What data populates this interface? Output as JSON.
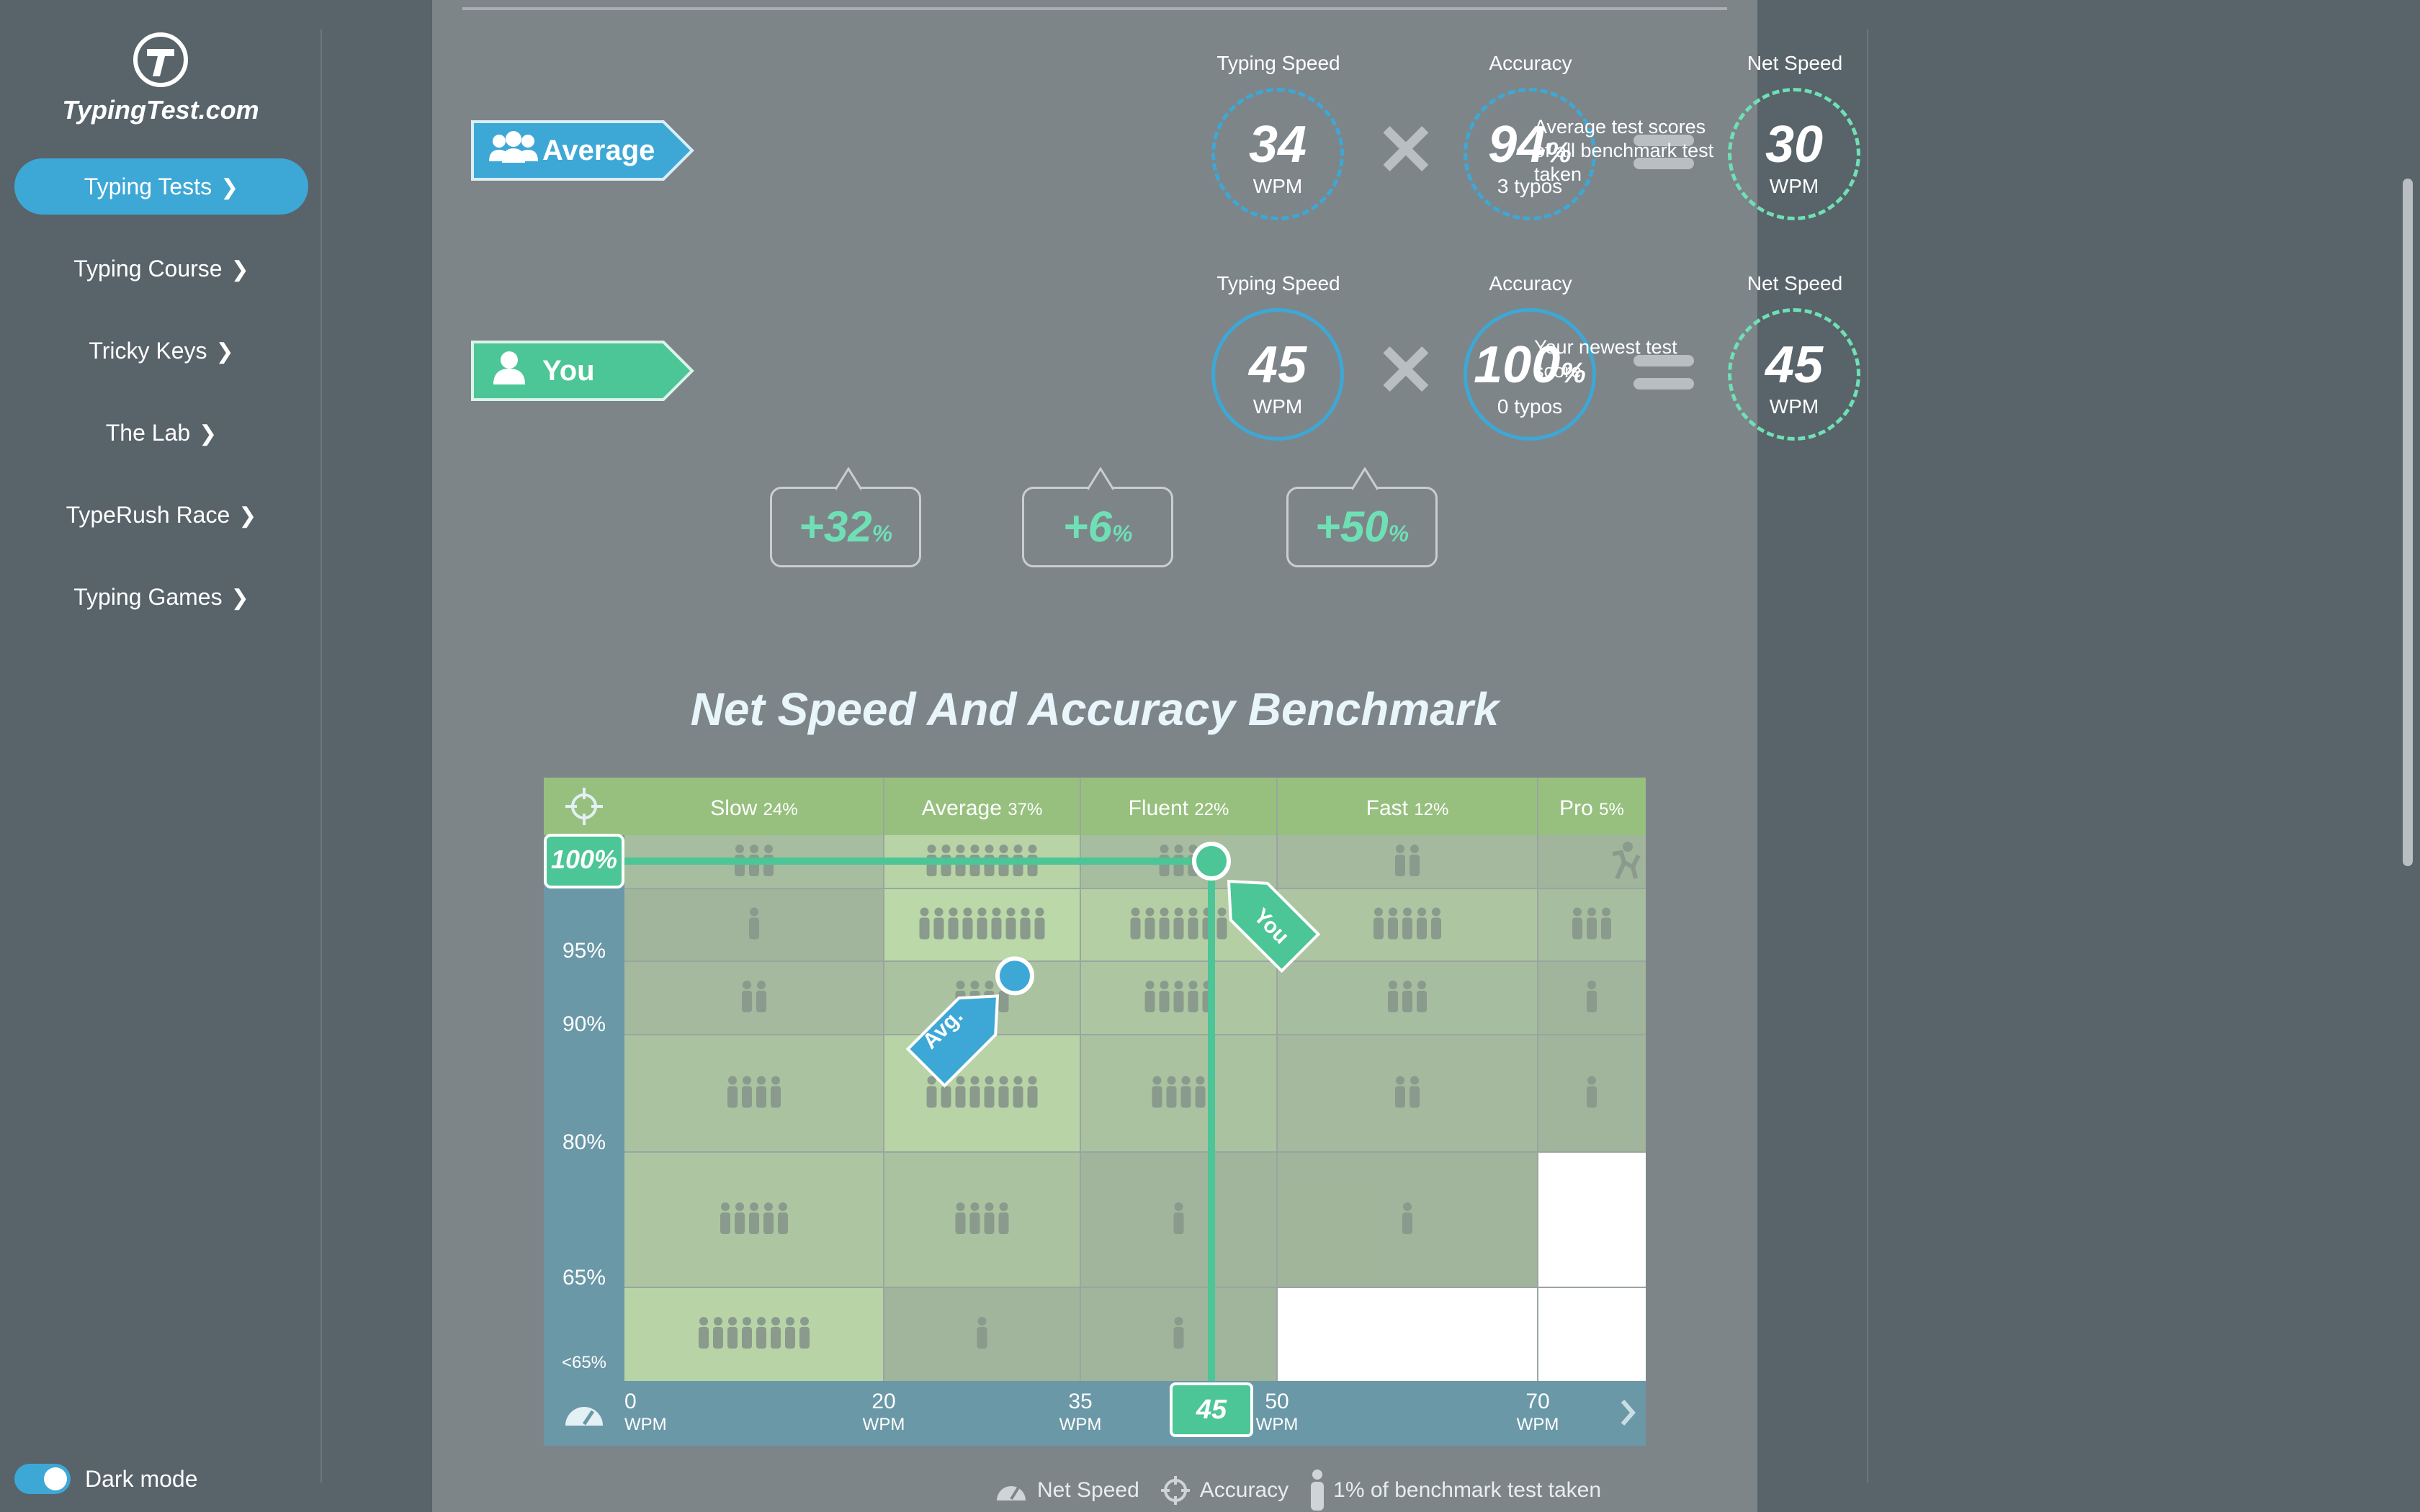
{
  "brand": {
    "name": "TypingTest.com"
  },
  "sidebar": {
    "items": [
      {
        "label": "Typing Tests",
        "active": true
      },
      {
        "label": "Typing Course"
      },
      {
        "label": "Tricky Keys"
      },
      {
        "label": "The Lab"
      },
      {
        "label": "TypeRush Race"
      },
      {
        "label": "Typing Games"
      }
    ],
    "dark_mode_label": "Dark mode",
    "dark_mode_on": true
  },
  "average": {
    "label": "Average",
    "speed_title": "Typing Speed",
    "speed": "34",
    "speed_unit": "WPM",
    "accuracy_title": "Accuracy",
    "accuracy": "94",
    "accuracy_sub": "3 typos",
    "net_title": "Net Speed",
    "net": "30",
    "net_unit": "WPM",
    "note": "Average test scores of all benchmark test taken"
  },
  "you": {
    "label": "You",
    "speed_title": "Typing Speed",
    "speed": "45",
    "speed_unit": "WPM",
    "accuracy_title": "Accuracy",
    "accuracy": "100",
    "accuracy_sub": "0 typos",
    "net_title": "Net Speed",
    "net": "45",
    "net_unit": "WPM",
    "note": "Your newest test score"
  },
  "diffs": {
    "speed": "+32",
    "accuracy": "+6",
    "net": "+50"
  },
  "pct_symbol": "%",
  "benchmark": {
    "title": "Net Speed And Accuracy Benchmark"
  },
  "chart_data": {
    "type": "heatmap",
    "columns": [
      {
        "name": "Slow",
        "pct": "24%"
      },
      {
        "name": "Average",
        "pct": "37%"
      },
      {
        "name": "Fluent",
        "pct": "22%"
      },
      {
        "name": "Fast",
        "pct": "12%"
      },
      {
        "name": "Pro",
        "pct": "5%"
      }
    ],
    "x_ticks": [
      "0",
      "20",
      "35",
      "50",
      "70"
    ],
    "x_unit": "WPM",
    "y_ticks": [
      "100%",
      "95%",
      "90%",
      "80%",
      "65%",
      "<65%"
    ],
    "counts": [
      [
        3,
        8,
        3,
        2,
        1
      ],
      [
        1,
        9,
        7,
        5,
        3
      ],
      [
        2,
        4,
        5,
        3,
        1
      ],
      [
        4,
        8,
        4,
        2,
        1
      ],
      [
        5,
        4,
        1,
        1,
        0
      ],
      [
        8,
        1,
        1,
        0,
        0
      ]
    ],
    "markers": {
      "you": {
        "label": "You",
        "net_speed": 45,
        "accuracy": 100
      },
      "avg": {
        "label": "Avg.",
        "net_speed": 30,
        "accuracy": 94
      }
    }
  },
  "legend": {
    "net_speed": "Net Speed",
    "accuracy": "Accuracy",
    "people": "1% of benchmark test taken"
  }
}
